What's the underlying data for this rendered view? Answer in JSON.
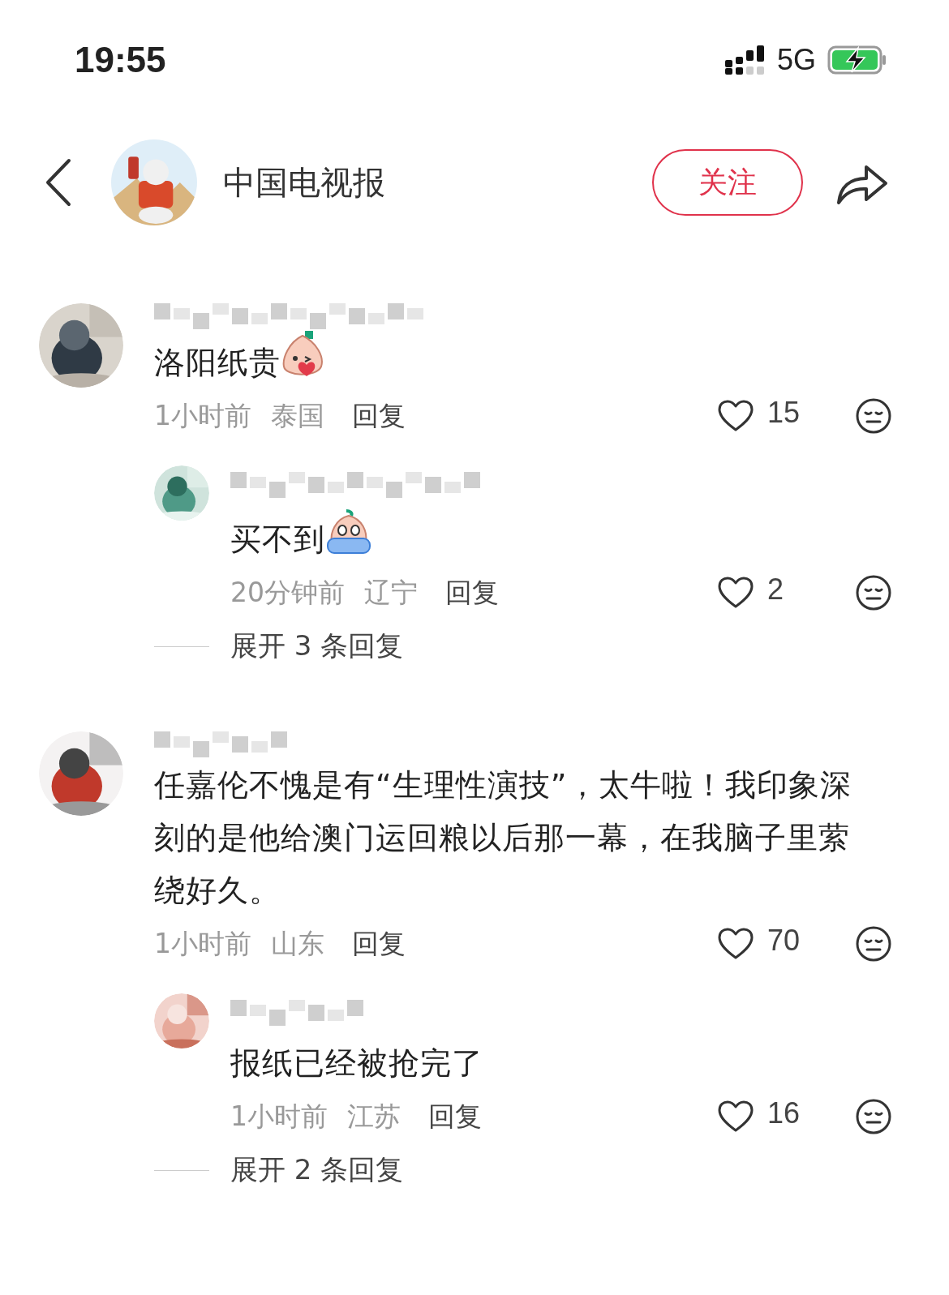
{
  "status_bar": {
    "time": "19:55",
    "network": "5G"
  },
  "header": {
    "title": "中国电视报",
    "follow_button": "关注"
  },
  "comments": [
    {
      "text": "洛阳纸贵",
      "emoji": true,
      "time": "1小时前",
      "location": "泰国",
      "reply_label": "回复",
      "likes": "15",
      "replies": [
        {
          "text": "买不到",
          "emoji": true,
          "time": "20分钟前",
          "location": "辽宁",
          "reply_label": "回复",
          "likes": "2"
        }
      ],
      "more_replies": "展开 3 条回复"
    },
    {
      "text": "任嘉伦不愧是有“生理性演技”，太牛啦！我印象深刻的是他给澳门运回粮以后那一幕，在我脑子里萦绕好久。",
      "time": "1小时前",
      "location": "山东",
      "reply_label": "回复",
      "likes": "70",
      "replies": [
        {
          "text": "报纸已经被抢完了",
          "time": "1小时前",
          "location": "江苏",
          "reply_label": "回复",
          "likes": "16"
        }
      ],
      "more_replies": "展开 2 条回复"
    }
  ]
}
